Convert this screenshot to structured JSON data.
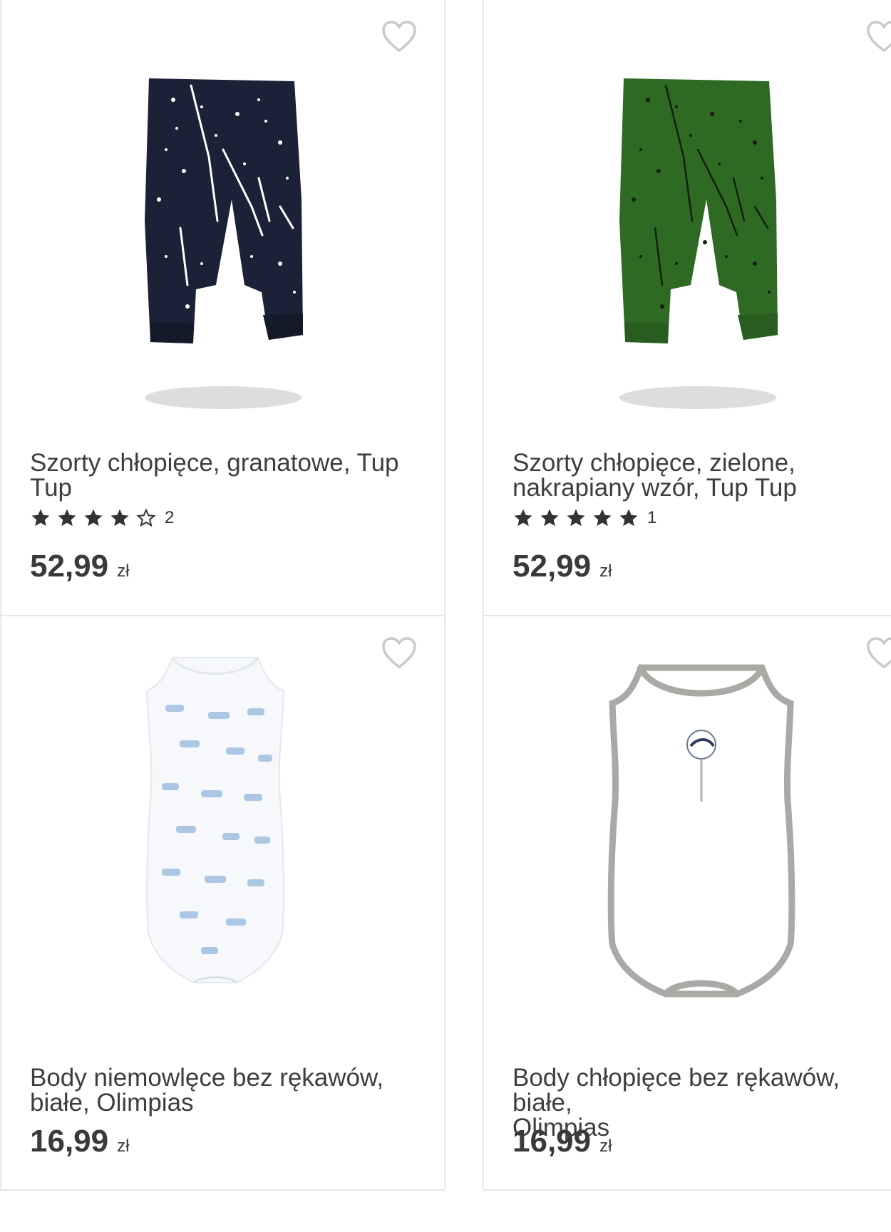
{
  "products": [
    {
      "title": "Szorty chłopięce, granatowe, Tup\nTup",
      "rating": 4,
      "review_count": "2",
      "price": "52,99",
      "currency": "zł",
      "image": "navy-shorts-splatter",
      "colors": {
        "main": "#1b2136"
      }
    },
    {
      "title": "Szorty chłopięce, zielone,\nnakrapiany wzór, Tup Tup",
      "rating": 5,
      "review_count": "1",
      "price": "52,99",
      "currency": "zł",
      "image": "green-shorts-splatter",
      "colors": {
        "main": "#2f6a25"
      }
    },
    {
      "title": "Body niemowlęce bez rękawów,\nbiałe, Olimpias",
      "price": "16,99",
      "currency": "zł",
      "image": "white-bodysuit-blue-print",
      "colors": {
        "main": "#f6f8fb"
      }
    },
    {
      "title": "Body chłopięce bez rękawów, białe,\nOlimpias",
      "price": "16,99",
      "currency": "zł",
      "image": "white-bodysuit-grey-trim",
      "colors": {
        "main": "#ffffff"
      }
    }
  ],
  "icons": {
    "favorite": "heart-outline-icon",
    "star_full": "star-filled-icon",
    "star_empty": "star-outline-icon"
  },
  "colors": {
    "border": "#e8e8e8",
    "text": "#3a3a3a",
    "heart": "#c9c9c9"
  }
}
